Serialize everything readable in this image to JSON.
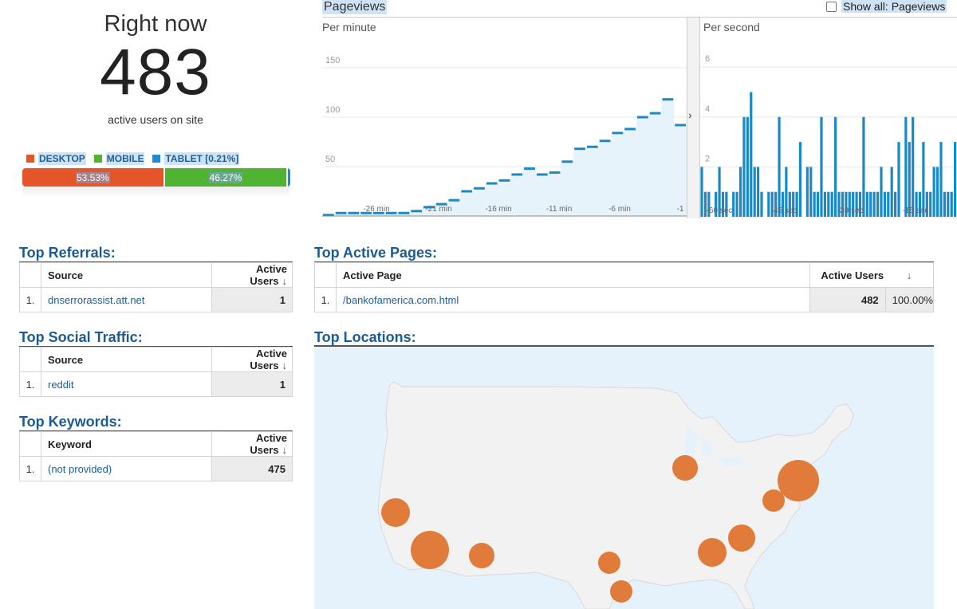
{
  "rightnow": {
    "heading": "Right now",
    "count": "483",
    "caption": "active users on site"
  },
  "devices": {
    "legend": [
      {
        "label": "DESKTOP",
        "color": "#e4562a"
      },
      {
        "label": "MOBILE",
        "color": "#50b432"
      },
      {
        "label": "TABLET [0.21%]",
        "color": "#1e8bd2"
      }
    ],
    "segments": [
      {
        "label": "53.53%",
        "share": 0.5353,
        "color": "#e4562a"
      },
      {
        "label": "46.27%",
        "share": 0.4627,
        "color": "#50b432"
      },
      {
        "label": "",
        "share": 0.0021,
        "color": "#1e8bd2"
      }
    ]
  },
  "pageviews": {
    "title": "Pageviews",
    "show_all_label": "Show all: Pageviews",
    "show_all_checked": false,
    "accent": "#1a8ac6",
    "per_minute": {
      "label": "Per minute",
      "y_ticks": [
        "150",
        "100",
        "50"
      ],
      "x_ticks": [
        "-26 min",
        "-21 min",
        "-16 min",
        "-11 min",
        "-6 min",
        "-1"
      ],
      "values": [
        1,
        3,
        3,
        3,
        3,
        3,
        3,
        5,
        9,
        12,
        16,
        25,
        28,
        33,
        36,
        42,
        48,
        42,
        44,
        55,
        68,
        70,
        76,
        84,
        88,
        100,
        104,
        118,
        92
      ]
    },
    "per_second": {
      "label": "Per second",
      "y_ticks": [
        "6",
        "4",
        "2"
      ],
      "x_ticks": [
        "-60 sec",
        "-45 sec",
        "-30 sec",
        "-15 sec"
      ],
      "values": [
        2,
        1,
        1,
        0,
        1,
        2,
        1,
        1,
        0,
        1,
        1,
        2,
        4,
        4,
        5,
        2,
        2,
        1,
        0,
        1,
        1,
        1,
        4,
        1,
        2,
        1,
        1,
        1,
        3,
        0,
        2,
        2,
        1,
        1,
        4,
        1,
        1,
        1,
        4,
        1,
        1,
        1,
        1,
        1,
        1,
        1,
        4,
        1,
        1,
        1,
        1,
        2,
        1,
        1,
        2,
        1,
        3,
        0,
        4,
        3,
        4,
        1,
        1,
        3,
        1,
        1,
        2,
        2,
        3,
        1,
        1,
        1,
        3
      ]
    }
  },
  "referrals": {
    "title": "Top Referrals:",
    "col_source": "Source",
    "col_users": "Active Users",
    "rows": [
      {
        "idx": "1.",
        "name": "dnserrorassist.att.net",
        "users": "1"
      }
    ]
  },
  "social": {
    "title": "Top Social Traffic:",
    "col_source": "Source",
    "col_users": "Active Users",
    "rows": [
      {
        "idx": "1.",
        "name": "reddit",
        "users": "1"
      }
    ]
  },
  "keywords": {
    "title": "Top Keywords:",
    "col_keyword": "Keyword",
    "col_users": "Active Users",
    "rows": [
      {
        "idx": "1.",
        "name": "(not provided)",
        "users": "475"
      }
    ]
  },
  "pages": {
    "title": "Top Active Pages:",
    "col_page": "Active Page",
    "col_users": "Active Users",
    "rows": [
      {
        "idx": "1.",
        "name": "/bankofamerica.com.html",
        "users": "482",
        "percent": "100.00%"
      }
    ]
  },
  "locations": {
    "title": "Top Locations:",
    "bubble_color": "#e07b39",
    "land_color": "#f2f2f2",
    "water_color": "#e6f2fb"
  },
  "icons": {
    "sort": "↓",
    "chevron": "›"
  }
}
